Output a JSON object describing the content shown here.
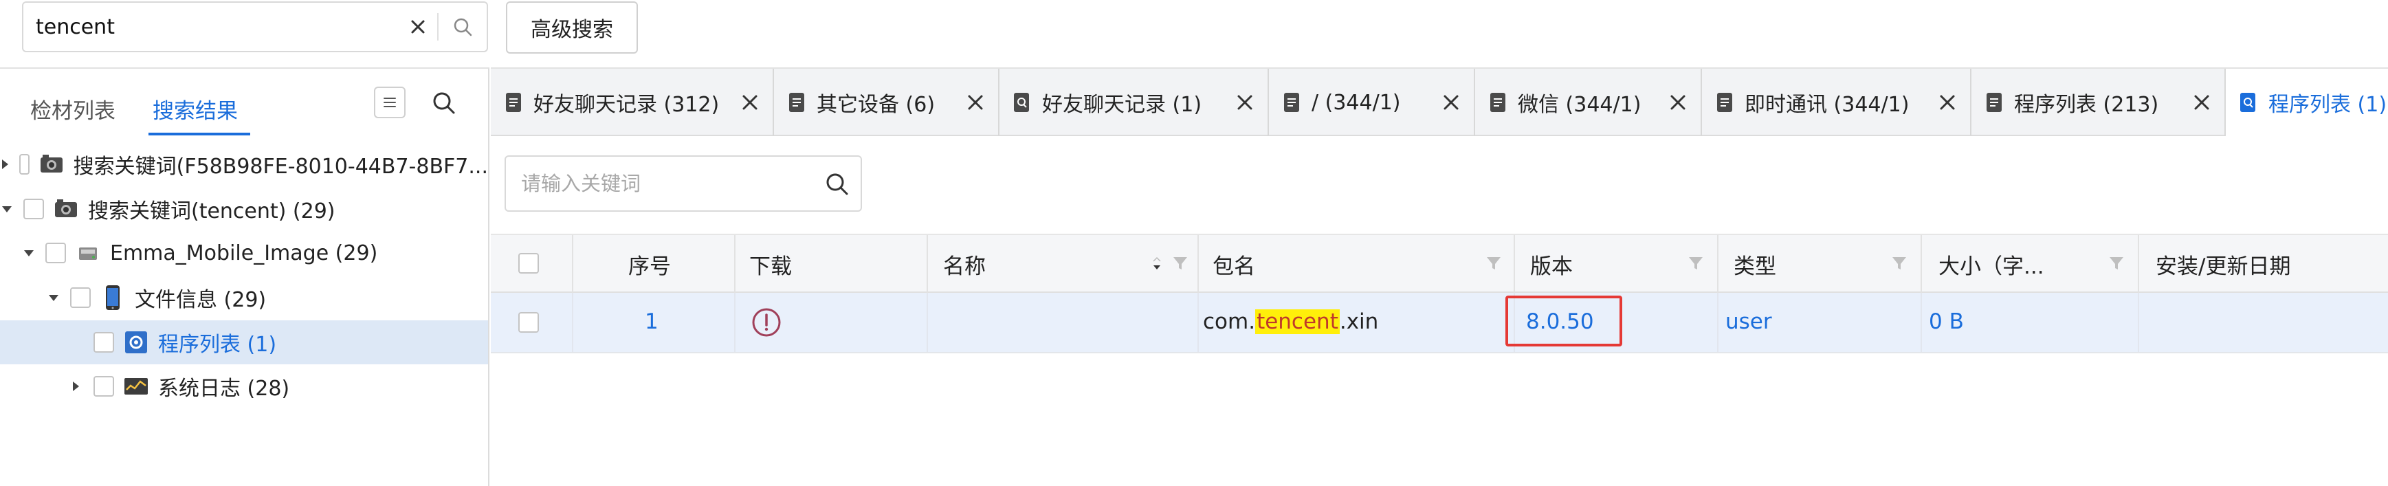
{
  "search": {
    "value": "tencent",
    "advanced_label": "高级搜索"
  },
  "left": {
    "tabs": [
      "检材列表",
      "搜索结果"
    ],
    "tree": [
      {
        "label": "搜索关键词(F58B98FE-8010-44B7-8BF7...",
        "icon": "search-keyword-icon"
      },
      {
        "label": "搜索关键词(tencent) (29)",
        "icon": "search-keyword-icon"
      },
      {
        "label": "Emma_Mobile_Image (29)",
        "icon": "disk-image-icon"
      },
      {
        "label": "文件信息 (29)",
        "icon": "phone-icon"
      },
      {
        "label": "程序列表 (1)",
        "icon": "app-list-icon"
      },
      {
        "label": "系统日志 (28)",
        "icon": "system-log-icon"
      }
    ]
  },
  "tabs": [
    {
      "label": "好友聊天记录 (312)",
      "icon": "document-icon"
    },
    {
      "label": "其它设备 (6)",
      "icon": "document-icon"
    },
    {
      "label": "好友聊天记录 (1)",
      "icon": "document-search-icon"
    },
    {
      "label": "/ (344/1)",
      "icon": "document-icon"
    },
    {
      "label": "微信 (344/1)",
      "icon": "document-icon"
    },
    {
      "label": "即时通讯 (344/1)",
      "icon": "document-icon"
    },
    {
      "label": "程序列表 (213)",
      "icon": "document-icon"
    },
    {
      "label": "程序列表 (1)",
      "icon": "document-search-icon"
    }
  ],
  "filter": {
    "placeholder": "请输入关键词"
  },
  "table": {
    "headers": {
      "seq": "序号",
      "download": "下载",
      "name": "名称",
      "package": "包名",
      "version": "版本",
      "type": "类型",
      "size": "大小（字...",
      "date": "安装/更新日期"
    },
    "row": {
      "seq": "1",
      "name": "",
      "package_pre": "com.",
      "package_hl": "tencent",
      "package_post": ".xin",
      "version": "8.0.50",
      "type": "user",
      "size": "0 B",
      "date": ""
    }
  },
  "colors": {
    "accent": "#1a6ddb",
    "highlight": "#ffef0a",
    "annotation": "#e53935"
  }
}
